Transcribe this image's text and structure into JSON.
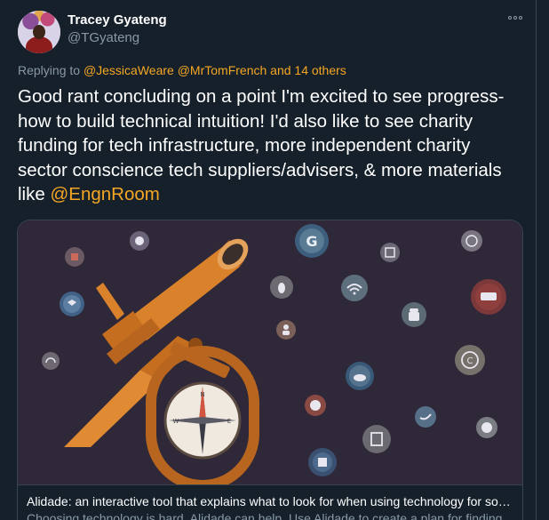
{
  "tweet": {
    "author": {
      "display_name": "Tracey Gyateng",
      "handle": "@TGyateng"
    },
    "replying_prefix": "Replying to",
    "replying_mentions": [
      "@JessicaWeare",
      "@MrTomFrench"
    ],
    "replying_suffix": "and 14 others",
    "text_main": "Good rant concluding on a point I'm excited to see progress- how to build technical intuition! I'd also like to see charity funding for tech infrastructure, more independent charity sector conscience tech suppliers/advisers, & more materials like ",
    "text_mention": "@EngnRoom"
  },
  "card": {
    "title": "Alidade: an interactive tool that explains what to look for when using technology for soc…",
    "description": "Choosing technology is hard. Alidade can help. Use Alidade to create a plan for finding…"
  },
  "colors": {
    "background": "#15202b",
    "accent": "#f5a623",
    "muted": "#8899a6",
    "card_bg": "#2e2838",
    "telescope": "#d9822b"
  },
  "icons": [
    "apple-icon",
    "google-icon",
    "compass-safari-icon",
    "html5-icon",
    "grid-icon",
    "linux-icon",
    "wifi-icon",
    "youtube-icon",
    "dropbox-icon",
    "android-icon",
    "user-icon",
    "copyright-icon",
    "dashboard-icon",
    "cloud-icon",
    "github-icon",
    "twitter-icon",
    "edge-icon",
    "facebook-icon"
  ]
}
